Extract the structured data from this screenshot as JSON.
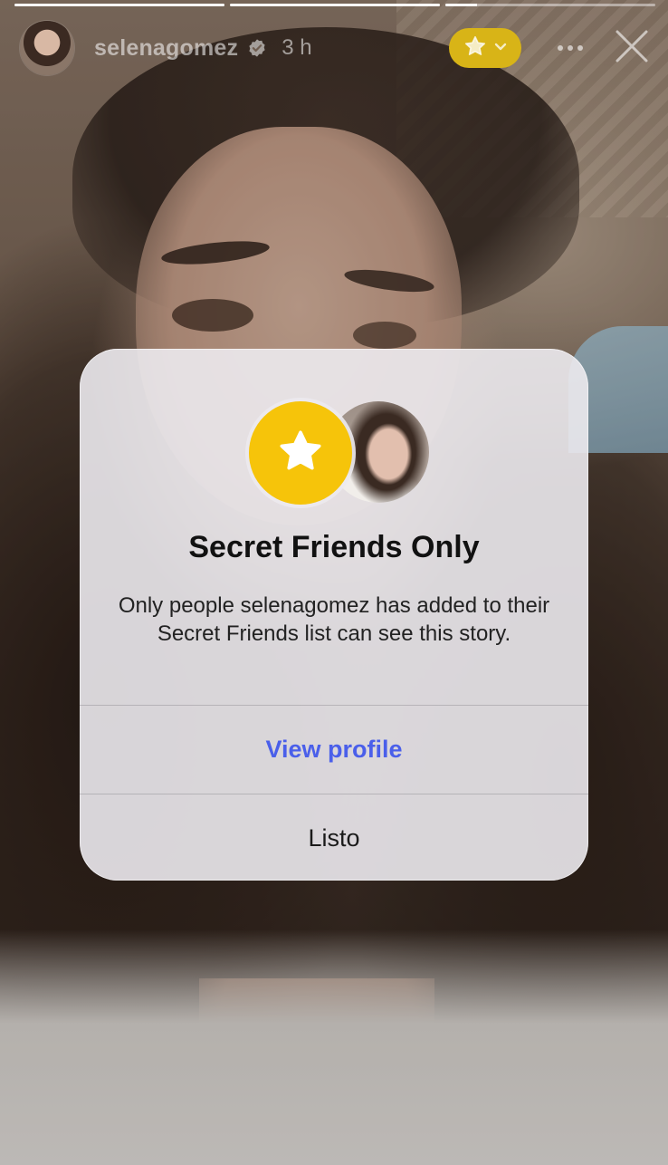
{
  "story": {
    "progress_segments": [
      1,
      1,
      0.15
    ],
    "username": "selenagomez",
    "time_ago": "3 h"
  },
  "header": {
    "icons": {
      "verified": "verified-badge-icon",
      "secret_friends": "star-icon",
      "dropdown": "chevron-down-icon",
      "more": "more-dots-icon",
      "close": "close-icon"
    },
    "accent_color": "#d8b417"
  },
  "dialog": {
    "title": "Secret Friends Only",
    "body": "Only people selenagomez has added to their Secret Friends list can see this story.",
    "primary_button": "View profile",
    "secondary_button": "Listo",
    "star_color": "#f6c40a",
    "link_color": "#4a5fea"
  }
}
